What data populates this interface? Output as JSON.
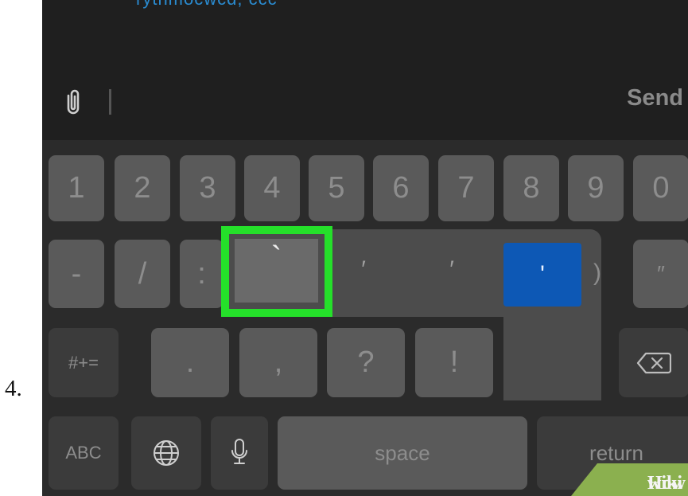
{
  "step_number": "4.",
  "composer": {
    "send_label": "Send",
    "attachment_icon": "paperclip-icon",
    "top_message_text": "rytnmocwcd, ccc"
  },
  "keyboard": {
    "number_row": [
      "1",
      "2",
      "3",
      "4",
      "5",
      "6",
      "7",
      "8",
      "9",
      "0"
    ],
    "symbol_row_visible": [
      "-",
      "/",
      ":",
      ")",
      "″"
    ],
    "punctuation_row": [
      ".",
      ",",
      "?",
      "!"
    ],
    "popup_chars": [
      "`",
      "′",
      "′",
      "'"
    ],
    "shift_label": "#+=",
    "abc_label": "ABC",
    "space_label": "space",
    "return_label": "return",
    "delete_icon": "backspace-icon",
    "globe_icon": "globe-icon",
    "mic_icon": "microphone-icon"
  },
  "watermark": {
    "wiki": "wiki",
    "how": "How",
    "color": "#8bb04f"
  },
  "highlight_color": "#25e02a",
  "selected_color": "#0d58b5"
}
